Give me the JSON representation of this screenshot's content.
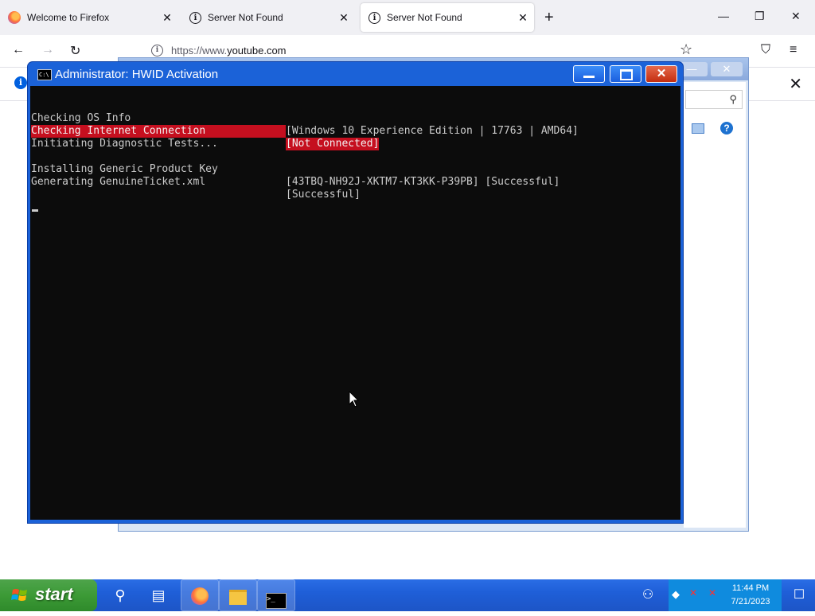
{
  "browser": {
    "tabs": [
      {
        "label": "Welcome to Firefox",
        "icon": "firefox-icon",
        "active": false
      },
      {
        "label": "Server Not Found",
        "icon": "info-icon",
        "active": false
      },
      {
        "label": "Server Not Found",
        "icon": "info-icon",
        "active": true
      }
    ],
    "new_tab": "+",
    "window_controls": {
      "minimize": "—",
      "restore": "❐",
      "close": "✕"
    },
    "nav": {
      "back": "←",
      "forward": "→",
      "reload": "↻"
    },
    "url": {
      "scheme": "https://www.",
      "host": "youtube.com"
    },
    "toolbar_icons": {
      "bookmark": "☆",
      "pocket": "⛉",
      "menu": "≡"
    },
    "notification": {
      "info": "i",
      "close": "✕"
    }
  },
  "background_window": {
    "buttons": {
      "minimize": "—",
      "close": "✕"
    },
    "help": "?"
  },
  "cmd": {
    "title": "Administrator:  HWID Activation",
    "icon_text": "C:\\",
    "buttons": {
      "minimize": "",
      "maximize": "",
      "close": "✕"
    },
    "lines": [
      {
        "label": "Checking OS Info",
        "value": "[Windows 10 Experience Edition | 17763 | AMD64]",
        "highlight": false
      },
      {
        "label": "Checking Internet Connection",
        "value": "[Not Connected]",
        "highlight": true
      },
      {
        "label": "Initiating Diagnostic Tests...",
        "value": "",
        "highlight": false
      },
      {
        "label": "",
        "value": "",
        "highlight": false
      },
      {
        "label": "Installing Generic Product Key",
        "value": "[43TBQ-NH92J-XKTM7-KT3KK-P39PB] [Successful]",
        "highlight": false
      },
      {
        "label": "Generating GenuineTicket.xml",
        "value": "[Successful]",
        "highlight": false
      }
    ],
    "colors": {
      "background": "#0c0c0c",
      "text": "#cccccc",
      "highlight": "#c50f1f",
      "titlebar": "#1b62d8"
    }
  },
  "taskbar": {
    "start_label": "start",
    "items": [
      {
        "name": "search-icon",
        "glyph": "⚲"
      },
      {
        "name": "task-view-icon",
        "glyph": "▤"
      },
      {
        "name": "firefox-taskbar-icon",
        "glyph": "●"
      },
      {
        "name": "file-explorer-icon",
        "glyph": "▬"
      },
      {
        "name": "cmd-taskbar-icon",
        "glyph": ">_"
      }
    ],
    "clock": {
      "time": "11:44 PM",
      "date": "7/21/2023"
    },
    "tray_icons": {
      "people": "⚇",
      "defender": "◆",
      "network": "✕",
      "volume": "✕"
    },
    "action_center": "☐"
  }
}
